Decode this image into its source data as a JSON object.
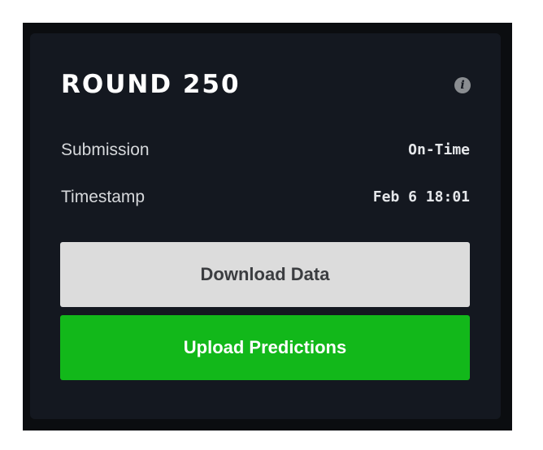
{
  "round": {
    "title": "ROUND 250",
    "info_icon": "info-icon"
  },
  "details": {
    "submission_label": "Submission",
    "submission_value": "On-Time",
    "timestamp_label": "Timestamp",
    "timestamp_value": "Feb 6 18:01"
  },
  "actions": {
    "download_label": "Download Data",
    "upload_label": "Upload Predictions"
  },
  "colors": {
    "card_background": "#141820",
    "upload_button": "#12b81a",
    "download_button": "#dcdcdc"
  }
}
